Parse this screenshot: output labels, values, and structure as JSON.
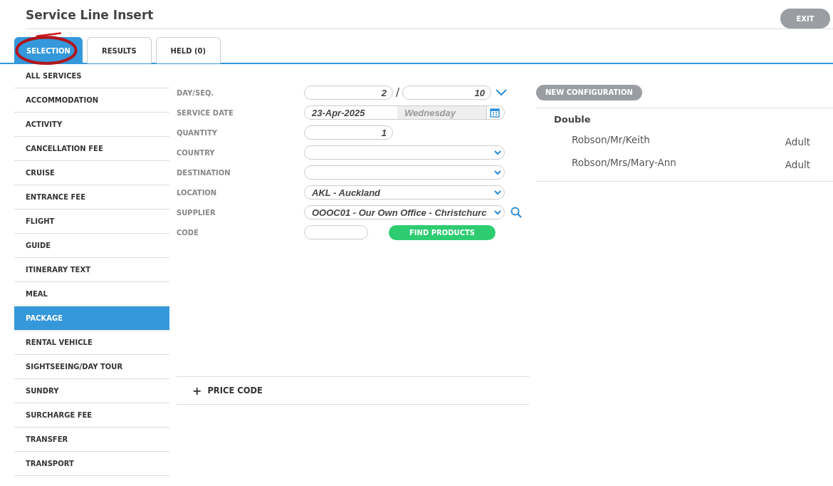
{
  "header": {
    "title": "Service Line Insert",
    "exit_button": "EXIT"
  },
  "tabs": [
    {
      "label": "SELECTION",
      "selected": true,
      "circled": true
    },
    {
      "label": "RESULTS",
      "selected": false,
      "circled": false
    },
    {
      "label": "HELD (0)",
      "selected": false,
      "circled": false
    }
  ],
  "sidebar": {
    "items": [
      {
        "label": "ALL SERVICES",
        "selected": false
      },
      {
        "label": "ACCOMMODATION",
        "selected": false
      },
      {
        "label": "ACTIVITY",
        "selected": false
      },
      {
        "label": "CANCELLATION FEE",
        "selected": false
      },
      {
        "label": "CRUISE",
        "selected": false
      },
      {
        "label": "ENTRANCE FEE",
        "selected": false
      },
      {
        "label": "FLIGHT",
        "selected": false
      },
      {
        "label": "GUIDE",
        "selected": false
      },
      {
        "label": "ITINERARY TEXT",
        "selected": false
      },
      {
        "label": "MEAL",
        "selected": false
      },
      {
        "label": "PACKAGE",
        "selected": true
      },
      {
        "label": "RENTAL VEHICLE",
        "selected": false
      },
      {
        "label": "SIGHTSEEING/DAY TOUR",
        "selected": false
      },
      {
        "label": "SUNDRY",
        "selected": false
      },
      {
        "label": "SURCHARGE FEE",
        "selected": false
      },
      {
        "label": "TRANSFER",
        "selected": false
      },
      {
        "label": "TRANSPORT",
        "selected": false
      }
    ]
  },
  "form": {
    "rows": [
      {
        "kind": "pair",
        "label": "DAY/SEQ.",
        "value": "2",
        "separator": "/",
        "value2": "10"
      },
      {
        "kind": "date",
        "label": "SERVICE DATE",
        "value": "23-Apr-2025",
        "weekday": "Wednesday"
      },
      {
        "kind": "number",
        "label": "QUANTITY",
        "value": "1"
      },
      {
        "kind": "select",
        "label": "COUNTRY",
        "value": ""
      },
      {
        "kind": "select",
        "label": "DESTINATION",
        "value": ""
      },
      {
        "kind": "select",
        "label": "LOCATION",
        "value": "AKL - Auckland"
      },
      {
        "kind": "lookup",
        "label": "SUPPLIER",
        "value": "OOOC01 - Our Own Office - Christchurc"
      },
      {
        "kind": "code",
        "label": "CODE",
        "value": "",
        "button": "FIND PRODUCTS"
      }
    ],
    "price_code": {
      "icon": "+",
      "label": "PRICE CODE"
    }
  },
  "configuration": {
    "button": "NEW CONFIGURATION",
    "room": "Double",
    "passengers": [
      {
        "name": "Robson/Mr/Keith",
        "type": "Adult"
      },
      {
        "name": "Robson/Mrs/Mary-Ann",
        "type": "Adult"
      }
    ]
  }
}
